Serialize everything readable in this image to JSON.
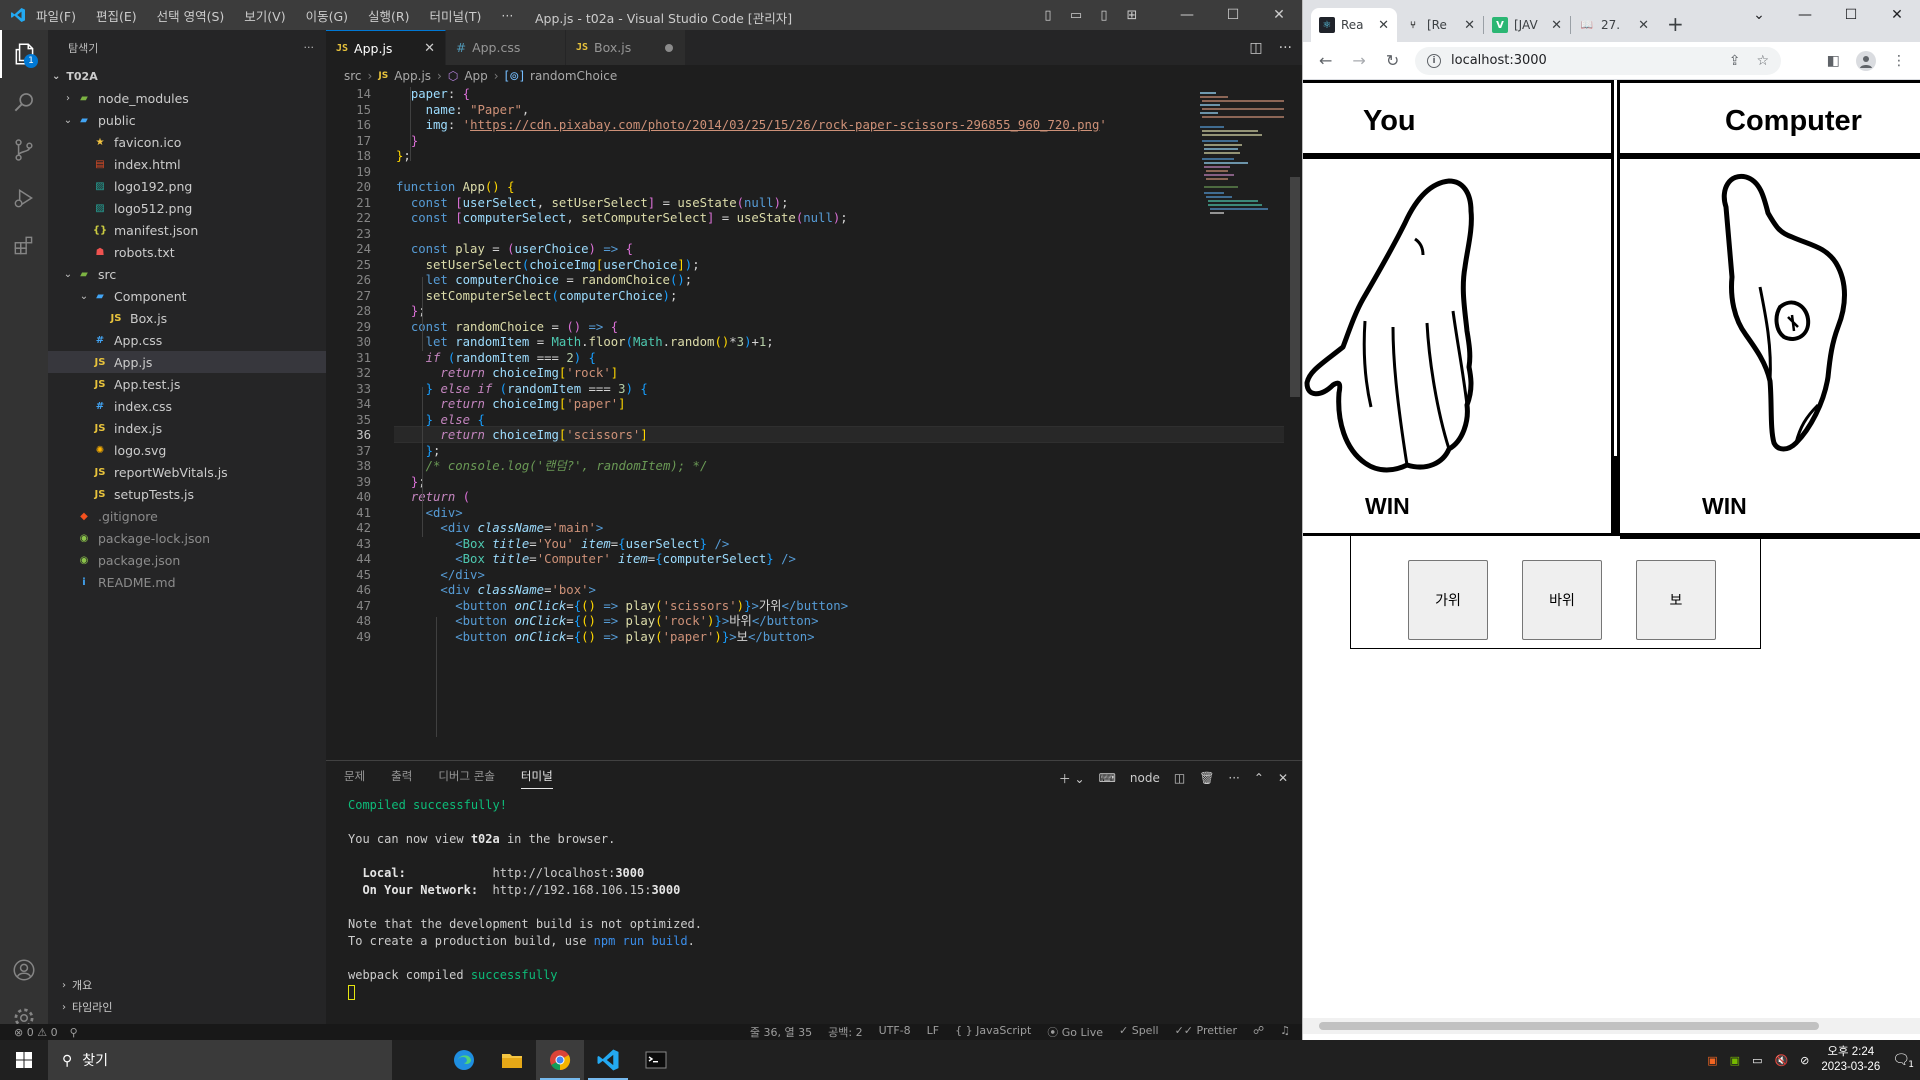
{
  "vscode": {
    "menu": [
      "파일(F)",
      "편집(E)",
      "선택 영역(S)",
      "보기(V)",
      "이동(G)",
      "실행(R)",
      "터미널(T)",
      "···"
    ],
    "window_title": "App.js - t02a - Visual Studio Code [관리자]",
    "explorer_badge": "1",
    "sidebar": {
      "title": "탐색기",
      "root": "T02A",
      "items": [
        {
          "label": "node_modules",
          "type": "folder-closed",
          "depth": 1,
          "icon": "folder-green-icon"
        },
        {
          "label": "public",
          "type": "folder-open",
          "depth": 1,
          "icon": "folder-blue-icon"
        },
        {
          "label": "favicon.ico",
          "type": "file",
          "depth": 2,
          "icon": "star-icon"
        },
        {
          "label": "index.html",
          "type": "file",
          "depth": 2,
          "icon": "html-icon"
        },
        {
          "label": "logo192.png",
          "type": "file",
          "depth": 2,
          "icon": "image-icon"
        },
        {
          "label": "logo512.png",
          "type": "file",
          "depth": 2,
          "icon": "image-icon"
        },
        {
          "label": "manifest.json",
          "type": "file",
          "depth": 2,
          "icon": "json-icon"
        },
        {
          "label": "robots.txt",
          "type": "file",
          "depth": 2,
          "icon": "robot-icon"
        },
        {
          "label": "src",
          "type": "folder-open",
          "depth": 1,
          "icon": "folder-green-icon"
        },
        {
          "label": "Component",
          "type": "folder-open",
          "depth": 2,
          "icon": "folder-blue-icon"
        },
        {
          "label": "Box.js",
          "type": "file",
          "depth": 3,
          "icon": "js-icon"
        },
        {
          "label": "App.css",
          "type": "file",
          "depth": 2,
          "icon": "css-icon"
        },
        {
          "label": "App.js",
          "type": "file",
          "depth": 2,
          "icon": "js-icon",
          "selected": true
        },
        {
          "label": "App.test.js",
          "type": "file",
          "depth": 2,
          "icon": "test-js-icon"
        },
        {
          "label": "index.css",
          "type": "file",
          "depth": 2,
          "icon": "css-icon"
        },
        {
          "label": "index.js",
          "type": "file",
          "depth": 2,
          "icon": "js-icon"
        },
        {
          "label": "logo.svg",
          "type": "file",
          "depth": 2,
          "icon": "svg-icon"
        },
        {
          "label": "reportWebVitals.js",
          "type": "file",
          "depth": 2,
          "icon": "js-icon"
        },
        {
          "label": "setupTests.js",
          "type": "file",
          "depth": 2,
          "icon": "js-icon"
        },
        {
          "label": ".gitignore",
          "type": "file",
          "depth": 1,
          "icon": "git-icon",
          "dim": true
        },
        {
          "label": "package-lock.json",
          "type": "file",
          "depth": 1,
          "icon": "npm-icon",
          "dim": true
        },
        {
          "label": "package.json",
          "type": "file",
          "depth": 1,
          "icon": "npm-icon",
          "dim": true
        },
        {
          "label": "README.md",
          "type": "file",
          "depth": 1,
          "icon": "info-icon",
          "dim": true
        }
      ],
      "outline": "개요",
      "timeline": "타임라인"
    },
    "tabs": [
      {
        "label": "App.js",
        "active": true,
        "kind": "js"
      },
      {
        "label": "App.css",
        "active": false,
        "kind": "css"
      },
      {
        "label": "Box.js",
        "active": false,
        "kind": "js",
        "dirty": true
      }
    ],
    "breadcrumb": [
      "src",
      "App.js",
      "App",
      "randomChoice"
    ],
    "code_lines": [
      {
        "n": "14",
        "html": "  <span class='v'>paper</span><span class='o'>: </span><span class='b2'>{</span>"
      },
      {
        "n": "15",
        "html": "    <span class='v'>name</span><span class='o'>: </span><span class='s'>\"Paper\"</span><span class='o'>,</span>"
      },
      {
        "n": "16",
        "html": "    <span class='v'>img</span><span class='o'>: </span><span class='s'>'</span><span class='url'>https://cdn.pixabay.com/photo/2014/03/25/15/26/rock-paper-scissors-296855_960_720.png</span><span class='s'>'</span>"
      },
      {
        "n": "17",
        "html": "  <span class='b2'>}</span>"
      },
      {
        "n": "18",
        "html": "<span class='b1'>}</span><span class='o'>;</span>"
      },
      {
        "n": "19",
        "html": ""
      },
      {
        "n": "20",
        "html": "<span class='k'>function</span> <span class='f'>App</span><span class='b1'>()</span> <span class='b1'>{</span>"
      },
      {
        "n": "21",
        "html": "  <span class='k'>const</span> <span class='b2'>[</span><span class='v'>userSelect</span><span class='o'>, </span><span class='f'>setUserSelect</span><span class='b2'>]</span> <span class='o'>=</span> <span class='f'>useState</span><span class='b2'>(</span><span class='k'>null</span><span class='b2'>)</span><span class='o'>;</span>"
      },
      {
        "n": "22",
        "html": "  <span class='k'>const</span> <span class='b2'>[</span><span class='v'>computerSelect</span><span class='o'>, </span><span class='f'>setComputerSelect</span><span class='b2'>]</span> <span class='o'>=</span> <span class='f'>useState</span><span class='b2'>(</span><span class='k'>null</span><span class='b2'>)</span><span class='o'>;</span>"
      },
      {
        "n": "23",
        "html": ""
      },
      {
        "n": "24",
        "html": "  <span class='k'>const</span> <span class='f'>play</span> <span class='o'>=</span> <span class='b2'>(</span><span class='v'>userChoice</span><span class='b2'>)</span> <span class='k'>=&gt;</span> <span class='b2'>{</span>"
      },
      {
        "n": "25",
        "html": "    <span class='f'>setUserSelect</span><span class='b3'>(</span><span class='v'>choiceImg</span><span class='b1'>[</span><span class='v'>userChoice</span><span class='b1'>]</span><span class='b3'>)</span><span class='o'>;</span>"
      },
      {
        "n": "26",
        "html": "    <span class='k'>let</span> <span class='v'>computerChoice</span> <span class='o'>=</span> <span class='f'>randomChoice</span><span class='b3'>()</span><span class='o'>;</span>"
      },
      {
        "n": "27",
        "html": "    <span class='f'>setComputerSelect</span><span class='b3'>(</span><span class='v'>computerChoice</span><span class='b3'>)</span><span class='o'>;</span>"
      },
      {
        "n": "28",
        "html": "  <span class='b2'>}</span><span class='o'>;</span>"
      },
      {
        "n": "29",
        "html": "  <span class='k'>const</span> <span class='f'>randomChoice</span> <span class='o'>=</span> <span class='b2'>()</span> <span class='k'>=&gt;</span> <span class='b2'>{</span>"
      },
      {
        "n": "30",
        "html": "    <span class='k'>let</span> <span class='v'>randomItem</span> <span class='o'>=</span> <span class='cc'>Math</span><span class='o'>.</span><span class='f'>floor</span><span class='b3'>(</span><span class='cc'>Math</span><span class='o'>.</span><span class='f'>random</span><span class='b1'>()</span><span class='o'>*</span><span class='n'>3</span><span class='b3'>)</span><span class='o'>+</span><span class='n'>1</span><span class='o'>;</span>"
      },
      {
        "n": "31",
        "html": "    <span class='kc'>if</span> <span class='b3'>(</span><span class='v'>randomItem</span> <span class='o'>===</span> <span class='n'>2</span><span class='b3'>)</span> <span class='b3'>{</span>"
      },
      {
        "n": "32",
        "html": "      <span class='kc'>return</span> <span class='v'>choiceImg</span><span class='b1'>[</span><span class='s'>'rock'</span><span class='b1'>]</span>"
      },
      {
        "n": "33",
        "html": "    <span class='b3'>}</span> <span class='kc'>else if</span> <span class='b3'>(</span><span class='v'>randomItem</span> <span class='o'>===</span> <span class='n'>3</span><span class='b3'>)</span> <span class='b3'>{</span>"
      },
      {
        "n": "34",
        "html": "      <span class='kc'>return</span> <span class='v'>choiceImg</span><span class='b1'>[</span><span class='s'>'paper'</span><span class='b1'>]</span>"
      },
      {
        "n": "35",
        "html": "    <span class='b3'>}</span> <span class='kc'>else</span> <span class='b3'>{</span>"
      },
      {
        "n": "36",
        "html": "      <span class='kc'>return</span> <span class='v'>choiceImg</span><span class='b1'>[</span><span class='s'>'scissors'</span><span class='b1'>]</span>",
        "current": true
      },
      {
        "n": "37",
        "html": "    <span class='b3'>}</span><span class='o'>;</span>"
      },
      {
        "n": "38",
        "html": "    <span class='cm'>/* console.log('랜덤?', randomItem); */</span>"
      },
      {
        "n": "39",
        "html": "  <span class='b2'>}</span><span class='o'>;</span>"
      },
      {
        "n": "40",
        "html": "  <span class='kc'>return</span> <span class='b2'>(</span>"
      },
      {
        "n": "41",
        "html": "    <span class='tg'>&lt;div&gt;</span>"
      },
      {
        "n": "42",
        "html": "      <span class='tg'>&lt;div</span> <span class='at'>className</span><span class='o'>=</span><span class='s'>'main'</span><span class='tg'>&gt;</span>"
      },
      {
        "n": "43",
        "html": "        <span class='tg'>&lt;</span><span class='cc'>Box</span> <span class='at'>title</span><span class='o'>=</span><span class='s'>'You'</span> <span class='at'>item</span><span class='o'>=</span><span class='b3'>{</span><span class='v'>userSelect</span><span class='b3'>}</span> <span class='tg'>/&gt;</span>"
      },
      {
        "n": "44",
        "html": "        <span class='tg'>&lt;</span><span class='cc'>Box</span> <span class='at'>title</span><span class='o'>=</span><span class='s'>'Computer'</span> <span class='at'>item</span><span class='o'>=</span><span class='b3'>{</span><span class='v'>computerSelect</span><span class='b3'>}</span> <span class='tg'>/&gt;</span>"
      },
      {
        "n": "45",
        "html": "      <span class='tg'>&lt;/div&gt;</span>"
      },
      {
        "n": "46",
        "html": "      <span class='tg'>&lt;div</span> <span class='at'>className</span><span class='o'>=</span><span class='s'>'box'</span><span class='tg'>&gt;</span>"
      },
      {
        "n": "47",
        "html": "        <span class='tg'>&lt;button</span> <span class='at'>onClick</span><span class='o'>=</span><span class='b3'>{</span><span class='b1'>()</span> <span class='k'>=&gt;</span> <span class='f'>play</span><span class='b1'>(</span><span class='s'>'scissors'</span><span class='b1'>)</span><span class='b3'>}</span><span class='tg'>&gt;</span><span class='p'>가위</span><span class='tg'>&lt;/button&gt;</span>"
      },
      {
        "n": "48",
        "html": "        <span class='tg'>&lt;button</span> <span class='at'>onClick</span><span class='o'>=</span><span class='b3'>{</span><span class='b1'>()</span> <span class='k'>=&gt;</span> <span class='f'>play</span><span class='b1'>(</span><span class='s'>'rock'</span><span class='b1'>)</span><span class='b3'>}</span><span class='tg'>&gt;</span><span class='p'>바위</span><span class='tg'>&lt;/button&gt;</span>"
      },
      {
        "n": "49",
        "html": "        <span class='tg'>&lt;button</span> <span class='at'>onClick</span><span class='o'>=</span><span class='b3'>{</span><span class='b1'>()</span> <span class='k'>=&gt;</span> <span class='f'>play</span><span class='b1'>(</span><span class='s'>'paper'</span><span class='b1'>)</span><span class='b3'>}</span><span class='tg'>&gt;</span><span class='p'>보</span><span class='tg'>&lt;/button&gt;</span>"
      }
    ],
    "panel": {
      "tabs": [
        "문제",
        "출력",
        "디버그 콘솔",
        "터미널"
      ],
      "active_tab": "터미널",
      "shell": "node",
      "terminal_lines": [
        {
          "html": "<span class='tgreen'>Compiled successfully!</span>"
        },
        {
          "html": ""
        },
        {
          "html": "You can now view <span class='tbold'>t02a</span> in the browser."
        },
        {
          "html": ""
        },
        {
          "html": "  <span class='tbold'>Local:</span>            http://localhost:<span class='tbold'>3000</span>"
        },
        {
          "html": "  <span class='tbold'>On Your Network:</span>  http://192.168.106.15:<span class='tbold'>3000</span>"
        },
        {
          "html": ""
        },
        {
          "html": "Note that the development build is not optimized."
        },
        {
          "html": "To create a production build, use <span class='tblue'>npm run build</span>."
        },
        {
          "html": ""
        },
        {
          "html": "webpack compiled <span class='tgreen'>successfully</span>"
        }
      ]
    },
    "status": {
      "errors": "0",
      "warnings": "0",
      "position": "줄 36, 열 35",
      "spaces": "공백: 2",
      "encoding": "UTF-8",
      "eol": "LF",
      "language": "JavaScript",
      "golive": "Go Live",
      "spell": "Spell",
      "prettier": "Prettier"
    }
  },
  "browser": {
    "tabs": [
      {
        "label": "Rea",
        "favicon": "react-icon",
        "active": true
      },
      {
        "label": "[Re",
        "favicon": "branch-icon"
      },
      {
        "label": "[JAV",
        "favicon": "v-icon"
      },
      {
        "label": "27.",
        "favicon": "book-icon"
      }
    ],
    "url": "localhost:3000",
    "page": {
      "boxes": [
        {
          "title": "You",
          "result": "WIN",
          "hand": "paper-hand-icon"
        },
        {
          "title": "Computer",
          "result": "WIN",
          "hand": "scissors-hand-icon"
        }
      ],
      "buttons": [
        "가위",
        "바위",
        "보"
      ]
    }
  },
  "taskbar": {
    "search_label": "찾기",
    "time": "오후 2:24",
    "date": "2023-03-26",
    "notif_count": "1"
  }
}
